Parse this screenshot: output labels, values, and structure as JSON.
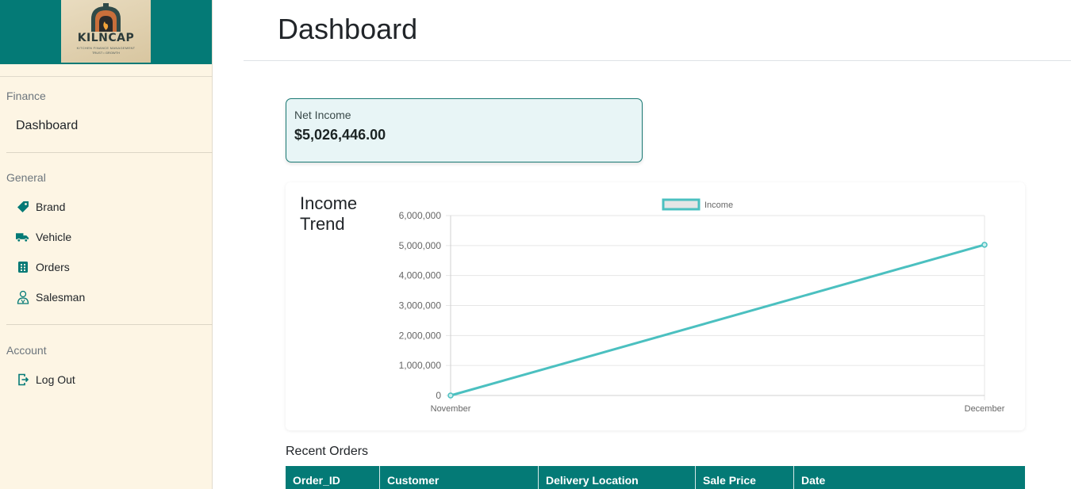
{
  "brand": {
    "logo_text": "KILNCAP",
    "logo_subtext": "KITCHEN FINANCE MANAGEMENT",
    "logo_tagline": "TRUST • GROWTH"
  },
  "sidebar": {
    "sections": [
      {
        "title": "Finance"
      },
      {
        "title": "General"
      },
      {
        "title": "Account"
      }
    ],
    "finance_items": [
      {
        "label": "Dashboard"
      }
    ],
    "general_items": [
      {
        "label": "Brand",
        "icon": "tag-icon"
      },
      {
        "label": "Vehicle",
        "icon": "truck-icon"
      },
      {
        "label": "Orders",
        "icon": "list-icon"
      },
      {
        "label": "Salesman",
        "icon": "person-icon"
      }
    ],
    "account_items": [
      {
        "label": "Log Out",
        "icon": "logout-icon"
      }
    ]
  },
  "header": {
    "title": "Dashboard"
  },
  "net_income": {
    "label": "Net Income",
    "value": "$5,026,446.00"
  },
  "chart": {
    "title_line1": "Income",
    "title_line2": "Trend"
  },
  "chart_data": {
    "type": "line",
    "title": "Income Trend",
    "categories": [
      "November",
      "December"
    ],
    "series": [
      {
        "name": "Income",
        "values": [
          0,
          5026446
        ]
      }
    ],
    "ylim": [
      0,
      6000000
    ],
    "yticks": [
      "0",
      "1,000,000",
      "2,000,000",
      "3,000,000",
      "4,000,000",
      "5,000,000",
      "6,000,000"
    ],
    "grid": true,
    "legend": "top-center",
    "color": "#4bc0c0"
  },
  "recent_orders": {
    "title": "Recent Orders",
    "columns": [
      "Order_ID",
      "Customer",
      "Delivery Location",
      "Sale Price",
      "Date"
    ]
  },
  "colors": {
    "accent": "#047a76",
    "sidebar_bg": "#fdf5e4",
    "card_bg": "#e8f5f6"
  }
}
